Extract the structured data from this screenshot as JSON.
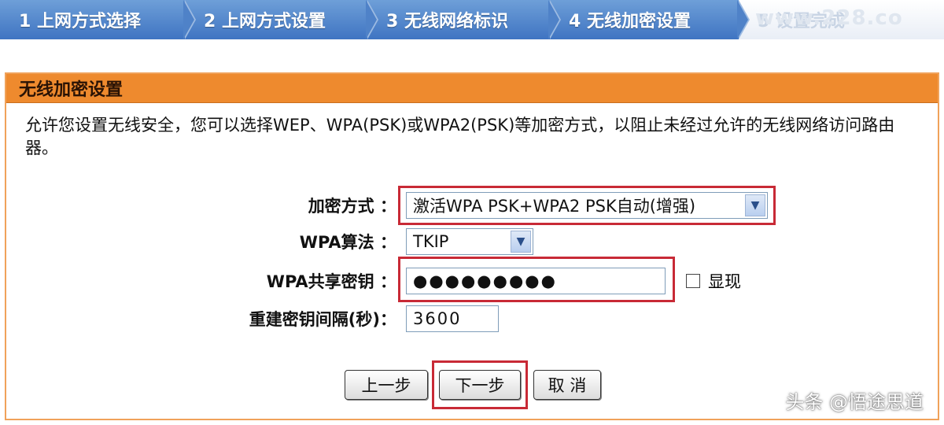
{
  "steps": [
    {
      "label": "1 上网方式选择"
    },
    {
      "label": "2 上网方式设置"
    },
    {
      "label": "3 无线网络标识"
    },
    {
      "label": "4 无线加密设置"
    },
    {
      "label": "5 设置完成"
    }
  ],
  "steps_watermark": "www.228.co",
  "panel": {
    "title": "无线加密设置",
    "description": "允许您设置无线安全，您可以选择WEP、WPA(PSK)或WPA2(PSK)等加密方式，以阻止未经过允许的无线网络访问路由器。"
  },
  "form": {
    "encryption_label": "加密方式 ：",
    "encryption_value": "激活WPA PSK+WPA2 PSK自动(增强)",
    "algorithm_label": "WPA算法 ：",
    "algorithm_value": "TKIP",
    "key_label": "WPA共享密钥 ：",
    "key_value": "●●●●●●●●●",
    "show_label": "显现",
    "interval_label": "重建密钥间隔(秒)：",
    "interval_value": "3600"
  },
  "buttons": {
    "prev": "上一步",
    "next": "下一步",
    "cancel": "取 消"
  },
  "watermark": "头条 @悟途思道",
  "colors": {
    "header_orange": "#ee8a2e",
    "highlight_red": "#c82a36",
    "step_blue": "#4f82c8"
  }
}
